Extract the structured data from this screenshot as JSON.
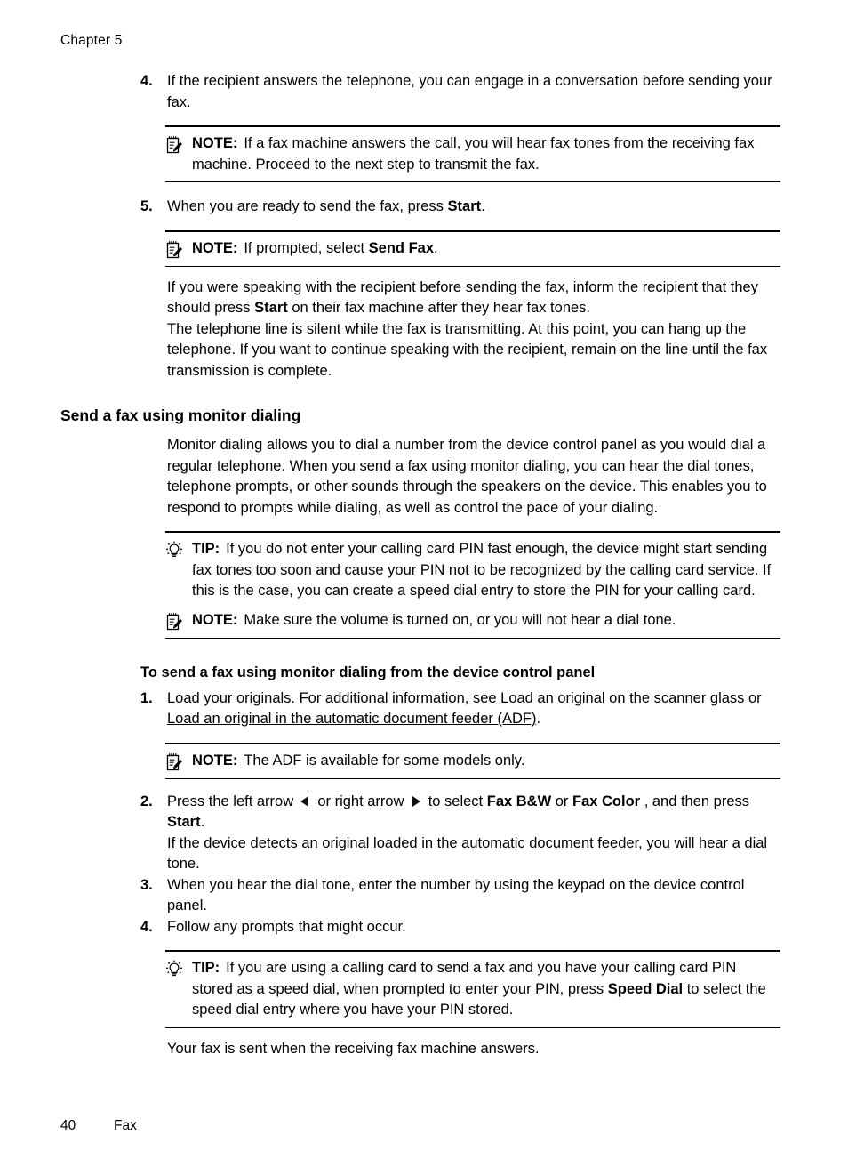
{
  "header": {
    "chapter_label": "Chapter 5"
  },
  "footer": {
    "page_number": "40",
    "section_name": "Fax"
  },
  "icons": {
    "note": "note-clipboard-pencil-icon",
    "tip": "tip-lightbulb-icon",
    "left_arrow": "left-arrow-icon",
    "right_arrow": "right-arrow-icon"
  },
  "labels": {
    "note": "NOTE:",
    "tip": "TIP:"
  },
  "step4": {
    "number": "4.",
    "text": "If the recipient answers the telephone, you can engage in a conversation before sending your fax."
  },
  "note1": {
    "text": "If a fax machine answers the call, you will hear fax tones from the receiving fax machine. Proceed to the next step to transmit the fax."
  },
  "step5": {
    "number": "5.",
    "text_before": "When you are ready to send the fax, press ",
    "bold": "Start",
    "text_after": "."
  },
  "note2": {
    "text_before": "If prompted, select ",
    "bold": "Send Fax",
    "text_after": "."
  },
  "para_after_note2": {
    "line1_before": "If you were speaking with the recipient before sending the fax, inform the recipient that they should press ",
    "line1_bold": "Start",
    "line1_after": " on their fax machine after they hear fax tones.",
    "line2": "The telephone line is silent while the fax is transmitting. At this point, you can hang up the telephone. If you want to continue speaking with the recipient, remain on the line until the fax transmission is complete."
  },
  "section": {
    "heading": "Send a fax using monitor dialing",
    "intro": "Monitor dialing allows you to dial a number from the device control panel as you would dial a regular telephone. When you send a fax using monitor dialing, you can hear the dial tones, telephone prompts, or other sounds through the speakers on the device. This enables you to respond to prompts while dialing, as well as control the pace of your dialing."
  },
  "tip1": {
    "text": "If you do not enter your calling card PIN fast enough, the device might start sending fax tones too soon and cause your PIN not to be recognized by the calling card service. If this is the case, you can create a speed dial entry to store the PIN for your calling card."
  },
  "note3": {
    "text": "Make sure the volume is turned on, or you will not hear a dial tone."
  },
  "procedure": {
    "heading": "To send a fax using monitor dialing from the device control panel",
    "step1": {
      "number": "1.",
      "text_before": "Load your originals. For additional information, see ",
      "link1": "Load an original on the scanner glass",
      "text_middle": " or ",
      "link2": "Load an original in the automatic document feeder (ADF)",
      "text_after": "."
    },
    "note4": {
      "text": "The ADF is available for some models only."
    },
    "step2": {
      "number": "2.",
      "t1": "Press the left arrow ",
      "t2": " or right arrow ",
      "t3": " to select ",
      "b1": "Fax B&W",
      "t4": " or ",
      "b2": "Fax Color",
      "t5": " , and then press ",
      "b3": "Start",
      "t6": ".",
      "extra": "If the device detects an original loaded in the automatic document feeder, you will hear a dial tone."
    },
    "step3": {
      "number": "3.",
      "text": "When you hear the dial tone, enter the number by using the keypad on the device control panel."
    },
    "step4": {
      "number": "4.",
      "text": "Follow any prompts that might occur."
    }
  },
  "tip2": {
    "text_before": "If you are using a calling card to send a fax and you have your calling card PIN stored as a speed dial, when prompted to enter your PIN, press ",
    "bold": "Speed Dial",
    "text_after": " to select the speed dial entry where you have your PIN stored."
  },
  "closing": {
    "text": "Your fax is sent when the receiving fax machine answers."
  }
}
